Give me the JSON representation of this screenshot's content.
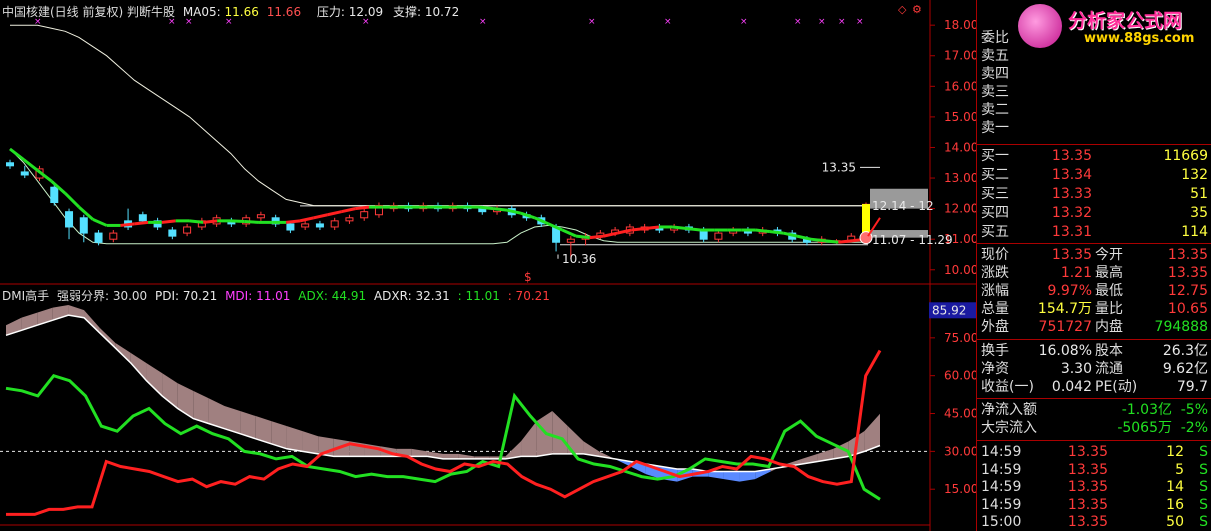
{
  "header": {
    "title": "中国核建(日线 前复权) 判断牛股",
    "ma_label": "MA05:",
    "ma_val1": "11.66",
    "ma_val2": "11.66",
    "pressure_label": "压力:",
    "pressure_val": "12.09",
    "support_label": "支撑:",
    "support_val": "10.72"
  },
  "lower_header": {
    "name": "DMI高手",
    "strength": "强弱分界: 30.00",
    "pdi": "PDI: 70.21",
    "mdi": "MDI: 11.01",
    "adx": "ADX: 44.91",
    "adxr": "ADXR: 32.31",
    "v1": ": 11.01",
    "v2": ": 70.21"
  },
  "annotations": {
    "high": "13.35",
    "low": "10.36",
    "range1": "12.14 - 12",
    "range2": "11.07 - 11.29",
    "current_axis": "85.92"
  },
  "logo": {
    "brand": "分析家公式网",
    "url": "www.88gs.com"
  },
  "colors": {
    "up": "#ff3a3a",
    "down": "#54e0ff",
    "ma": "#22e022",
    "bg": "#000000",
    "axis": "#aa0000"
  },
  "chart_data": [
    {
      "type": "candlestick",
      "y_ticks": [
        "18.00",
        "17.00",
        "16.00",
        "15.00",
        "14.00",
        "13.00",
        "12.00",
        "11.00",
        "10.00"
      ],
      "ylim": [
        9.6,
        18.3
      ],
      "pressure": 12.09,
      "support": 10.72,
      "series": [
        {
          "name": "MA05",
          "values": [
            13.95,
            13.6,
            13.25,
            12.9,
            12.5,
            12.05,
            11.65,
            11.45,
            11.45,
            11.5,
            11.55,
            11.55,
            11.6,
            11.6,
            11.55,
            11.6,
            11.6,
            11.58,
            11.55,
            11.55,
            11.55,
            11.6,
            11.7,
            11.8,
            11.9,
            12.0,
            12.05,
            12.05,
            12.05,
            12.05,
            12.05,
            12.05,
            12.05,
            12.05,
            12.05,
            12.0,
            11.95,
            11.85,
            11.7,
            11.5,
            11.3,
            11.1,
            11.05,
            11.1,
            11.2,
            11.3,
            11.35,
            11.4,
            11.4,
            11.35,
            11.3,
            11.3,
            11.3,
            11.3,
            11.3,
            11.25,
            11.2,
            11.1,
            11.0,
            10.95,
            10.9,
            10.95,
            11.0
          ]
        },
        {
          "name": "ref_upper",
          "values": [
            18.0,
            18.0,
            18.0,
            17.9,
            17.8,
            17.6,
            17.3,
            17.0,
            16.6,
            16.2,
            15.9,
            15.6,
            15.3,
            15.0,
            14.6,
            14.2,
            13.8,
            13.3,
            12.9,
            12.6,
            12.3,
            12.2,
            12.1,
            12.1,
            12.1,
            12.1,
            12.1,
            12.1,
            12.1,
            12.1,
            12.1,
            12.1,
            12.1,
            12.1,
            12.1,
            12.1,
            12.1,
            12.1,
            12.1,
            12.1,
            12.1,
            12.1,
            12.1,
            12.1,
            12.1,
            12.1,
            12.1,
            12.1,
            12.1,
            12.1,
            12.1,
            12.1,
            12.1,
            12.1,
            12.1,
            12.1,
            12.1,
            12.1,
            12.1,
            12.1,
            12.1,
            12.1,
            12.1
          ]
        },
        {
          "name": "ref_lower",
          "values": [
            13.95,
            13.5,
            12.9,
            12.3,
            11.7,
            11.2,
            10.9,
            10.85,
            10.85,
            10.85,
            10.85,
            10.85,
            10.85,
            10.85,
            10.85,
            10.85,
            10.85,
            10.85,
            10.85,
            10.85,
            10.85,
            10.85,
            10.85,
            10.85,
            10.85,
            10.85,
            10.85,
            10.85,
            10.85,
            10.85,
            10.85,
            10.85,
            10.85,
            10.85,
            10.85,
            10.85,
            10.9,
            11.2,
            11.4,
            11.45,
            11.4,
            11.3,
            11.1,
            10.95,
            10.9,
            10.9,
            10.9,
            10.9,
            10.9,
            10.9,
            10.9,
            10.9,
            10.9,
            10.9,
            10.9,
            10.9,
            10.9,
            10.9,
            10.9,
            10.9,
            10.9,
            10.9,
            10.9
          ]
        }
      ],
      "candles": [
        [
          13.5,
          13.4,
          13.6,
          13.3
        ],
        [
          13.2,
          13.1,
          13.4,
          13.0
        ],
        [
          13.0,
          13.3,
          13.4,
          12.9
        ],
        [
          12.7,
          12.2,
          12.8,
          12.1
        ],
        [
          11.9,
          11.4,
          12.0,
          11.0
        ],
        [
          11.7,
          11.2,
          11.8,
          10.9
        ],
        [
          11.2,
          10.9,
          11.3,
          10.8
        ],
        [
          11.0,
          11.2,
          11.3,
          10.9
        ],
        [
          11.6,
          11.4,
          12.0,
          11.3
        ],
        [
          11.8,
          11.6,
          11.9,
          11.5
        ],
        [
          11.6,
          11.4,
          11.7,
          11.3
        ],
        [
          11.3,
          11.1,
          11.4,
          11.0
        ],
        [
          11.2,
          11.4,
          11.5,
          11.1
        ],
        [
          11.4,
          11.6,
          11.7,
          11.3
        ],
        [
          11.5,
          11.7,
          11.8,
          11.4
        ],
        [
          11.6,
          11.5,
          11.7,
          11.4
        ],
        [
          11.5,
          11.7,
          11.8,
          11.4
        ],
        [
          11.7,
          11.8,
          11.9,
          11.6
        ],
        [
          11.7,
          11.5,
          11.8,
          11.4
        ],
        [
          11.5,
          11.3,
          11.6,
          11.2
        ],
        [
          11.4,
          11.5,
          11.6,
          11.3
        ],
        [
          11.5,
          11.4,
          11.6,
          11.3
        ],
        [
          11.4,
          11.6,
          11.7,
          11.3
        ],
        [
          11.6,
          11.7,
          11.8,
          11.5
        ],
        [
          11.7,
          11.9,
          12.0,
          11.6
        ],
        [
          11.8,
          12.1,
          12.2,
          11.7
        ],
        [
          12.0,
          12.1,
          12.2,
          11.9
        ],
        [
          12.1,
          12.0,
          12.2,
          11.9
        ],
        [
          12.0,
          12.1,
          12.2,
          11.9
        ],
        [
          12.1,
          12.0,
          12.2,
          11.9
        ],
        [
          12.0,
          12.1,
          12.2,
          11.9
        ],
        [
          12.1,
          12.0,
          12.2,
          11.9
        ],
        [
          12.0,
          11.9,
          12.1,
          11.8
        ],
        [
          11.9,
          12.0,
          12.1,
          11.8
        ],
        [
          12.0,
          11.8,
          12.1,
          11.7
        ],
        [
          11.8,
          11.7,
          11.9,
          11.6
        ],
        [
          11.7,
          11.5,
          11.8,
          11.4
        ],
        [
          11.4,
          10.9,
          11.5,
          10.6
        ],
        [
          10.9,
          11.0,
          11.1,
          10.36
        ],
        [
          11.0,
          11.1,
          11.2,
          10.8
        ],
        [
          11.1,
          11.2,
          11.3,
          11.0
        ],
        [
          11.2,
          11.3,
          11.4,
          11.1
        ],
        [
          11.2,
          11.4,
          11.5,
          11.1
        ],
        [
          11.3,
          11.4,
          11.5,
          11.2
        ],
        [
          11.4,
          11.3,
          11.5,
          11.2
        ],
        [
          11.3,
          11.4,
          11.5,
          11.2
        ],
        [
          11.4,
          11.3,
          11.5,
          11.2
        ],
        [
          11.3,
          11.0,
          11.4,
          10.9
        ],
        [
          11.0,
          11.2,
          11.3,
          10.9
        ],
        [
          11.2,
          11.3,
          11.4,
          11.1
        ],
        [
          11.3,
          11.2,
          11.4,
          11.1
        ],
        [
          11.2,
          11.3,
          11.4,
          11.1
        ],
        [
          11.3,
          11.2,
          11.4,
          11.1
        ],
        [
          11.2,
          11.0,
          11.3,
          10.9
        ],
        [
          11.0,
          10.9,
          11.1,
          10.8
        ],
        [
          10.9,
          11.0,
          11.1,
          10.8
        ],
        [
          10.9,
          10.95,
          11.0,
          10.85
        ],
        [
          10.95,
          11.1,
          11.2,
          10.9
        ],
        [
          11.1,
          12.14,
          12.2,
          11.07
        ]
      ]
    },
    {
      "type": "line",
      "y_ticks": [
        "75.00",
        "60.00",
        "45.00",
        "30.00",
        "15.00"
      ],
      "ylim": [
        2,
        90
      ],
      "threshold": 30.0,
      "series": [
        {
          "name": "PDI",
          "values": [
            5,
            5,
            5,
            7,
            7,
            8,
            8,
            26,
            24,
            23,
            22,
            20,
            18,
            19,
            16,
            18,
            17,
            20,
            19,
            23,
            25,
            24,
            29,
            31,
            33,
            32,
            31,
            29,
            28,
            25,
            23,
            22,
            25,
            24,
            26,
            25,
            20,
            17,
            15,
            12,
            15,
            18,
            20,
            22,
            26,
            24,
            22,
            20,
            21,
            22,
            24,
            23,
            28,
            27,
            25,
            24,
            20,
            18,
            17,
            18,
            60,
            70
          ]
        },
        {
          "name": "MDI",
          "values": [
            55,
            54,
            52,
            60,
            58,
            52,
            40,
            38,
            44,
            47,
            41,
            37,
            40,
            37,
            35,
            30,
            29,
            27,
            28,
            24,
            23,
            22,
            20,
            21,
            20,
            20,
            19,
            18,
            21,
            22,
            26,
            24,
            52,
            44,
            37,
            35,
            27,
            25,
            24,
            22,
            20,
            19,
            20,
            23,
            27,
            26,
            25,
            25,
            24,
            38,
            42,
            36,
            33,
            30,
            15,
            11
          ]
        },
        {
          "name": "ADX",
          "values": [
            80,
            83,
            85,
            87,
            88,
            86,
            79,
            73,
            69,
            65,
            61,
            57,
            54,
            51,
            48,
            46,
            44,
            42,
            40,
            38,
            36,
            35,
            34,
            33,
            32,
            31,
            31,
            30,
            29,
            29,
            28,
            28,
            28,
            34,
            42,
            46,
            40,
            34,
            30,
            27,
            24,
            21,
            19,
            18,
            20,
            20,
            19,
            18,
            19,
            22,
            25,
            27,
            29,
            31,
            34,
            38,
            44.91
          ]
        },
        {
          "name": "ADXR",
          "values": [
            76,
            78,
            80,
            82,
            84,
            83,
            77,
            71,
            65,
            58,
            52,
            47,
            43,
            41,
            39,
            37,
            35,
            33,
            31,
            30,
            29,
            28,
            28,
            28,
            28,
            28,
            28,
            28,
            27,
            27,
            27,
            27,
            27,
            28,
            28,
            29,
            29,
            29,
            28,
            27,
            26,
            25,
            24,
            23,
            23,
            22,
            22,
            22,
            22,
            23,
            24,
            25,
            26,
            27,
            28,
            30,
            32.31
          ]
        }
      ]
    }
  ],
  "quote": {
    "wei_bi": "委比",
    "asks": [
      {
        "label": "卖五"
      },
      {
        "label": "卖四"
      },
      {
        "label": "卖三"
      },
      {
        "label": "卖二"
      },
      {
        "label": "卖一"
      }
    ],
    "bids": [
      {
        "label": "买一",
        "price": "13.35",
        "vol": "11669"
      },
      {
        "label": "买二",
        "price": "13.34",
        "vol": "132"
      },
      {
        "label": "买三",
        "price": "13.33",
        "vol": "51"
      },
      {
        "label": "买四",
        "price": "13.32",
        "vol": "35"
      },
      {
        "label": "买五",
        "price": "13.31",
        "vol": "114"
      }
    ],
    "stats": [
      {
        "l1": "现价",
        "v1": "13.35",
        "c1": "red",
        "l2": "今开",
        "v2": "13.35",
        "c2": "red"
      },
      {
        "l1": "涨跌",
        "v1": "1.21",
        "c1": "red",
        "l2": "最高",
        "v2": "13.35",
        "c2": "red"
      },
      {
        "l1": "涨幅",
        "v1": "9.97%",
        "c1": "red",
        "l2": "最低",
        "v2": "12.75",
        "c2": "red"
      },
      {
        "l1": "总量",
        "v1": "154.7万",
        "c1": "yellow",
        "l2": "量比",
        "v2": "10.65",
        "c2": "red"
      },
      {
        "l1": "外盘",
        "v1": "751727",
        "c1": "red",
        "l2": "内盘",
        "v2": "794888",
        "c2": "green"
      }
    ],
    "stats2": [
      {
        "l1": "换手",
        "v1": "16.08%",
        "c1": "white",
        "l2": "股本",
        "v2": "26.3亿",
        "c2": "white"
      },
      {
        "l1": "净资",
        "v1": "3.30",
        "c1": "white",
        "l2": "流通",
        "v2": "9.62亿",
        "c2": "white"
      },
      {
        "l1": "收益(一)",
        "v1": "0.042",
        "c1": "white",
        "l2": "PE(动)",
        "v2": "79.7",
        "c2": "white"
      }
    ],
    "flows": [
      {
        "l": "净流入额",
        "v": "-1.03亿",
        "p": "-5%"
      },
      {
        "l": "大宗流入",
        "v": "-5065万",
        "p": "-2%"
      }
    ],
    "ticks": [
      {
        "t": "14:59",
        "p": "13.35",
        "v": "12",
        "s": "S"
      },
      {
        "t": "14:59",
        "p": "13.35",
        "v": "5",
        "s": "S"
      },
      {
        "t": "14:59",
        "p": "13.35",
        "v": "14",
        "s": "S"
      },
      {
        "t": "14:59",
        "p": "13.35",
        "v": "16",
        "s": "S"
      },
      {
        "t": "15:00",
        "p": "13.35",
        "v": "50",
        "s": "S"
      }
    ]
  }
}
